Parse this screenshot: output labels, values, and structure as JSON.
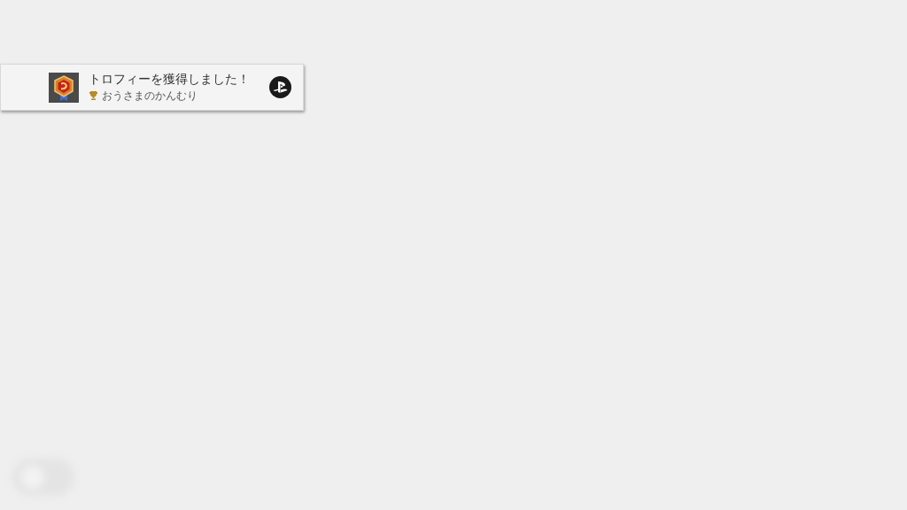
{
  "notification": {
    "title": "トロフィーを獲得しました！",
    "trophy_name": "おうさまのかんむり"
  }
}
